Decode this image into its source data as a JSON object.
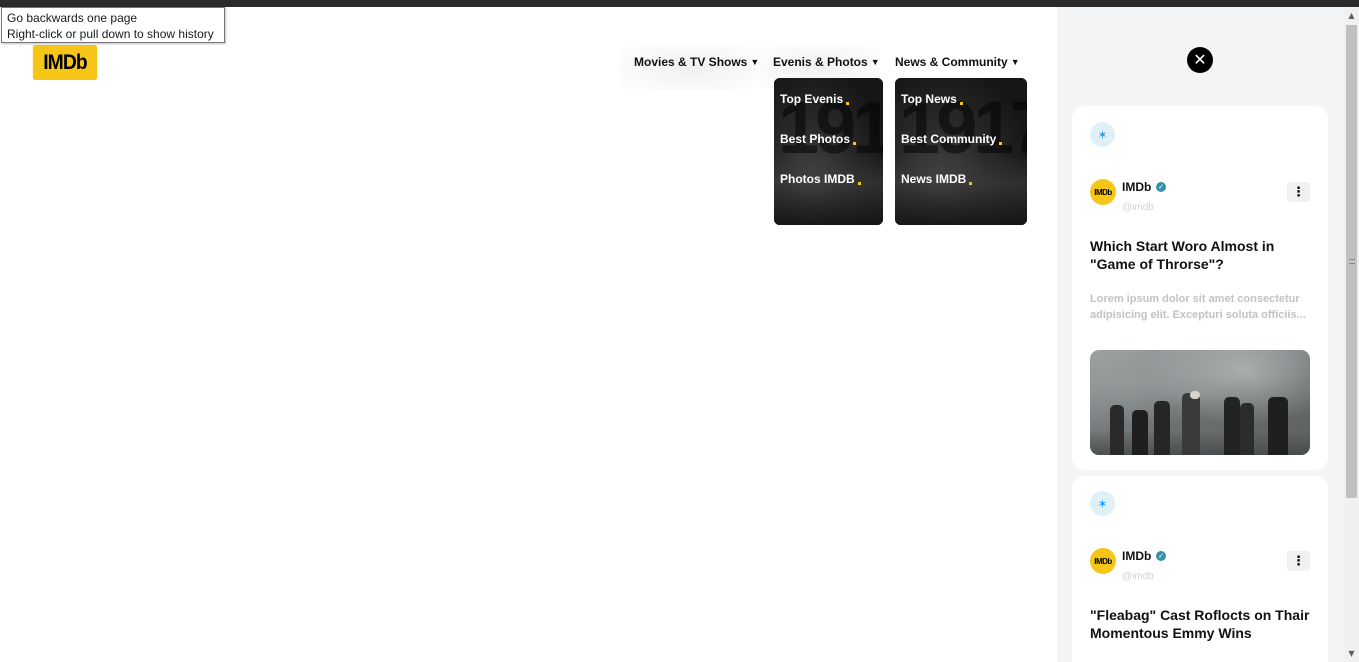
{
  "tooltip": {
    "line1": "Go backwards one page",
    "line2": "Right-click or pull down to show history"
  },
  "logo": {
    "text": "IMDb",
    "color": "#f5c518"
  },
  "nav": {
    "items": [
      {
        "label": "Movies & TV Shows",
        "icon": "chevron-down-icon"
      },
      {
        "label": "Evenis & Photos",
        "icon": "chevron-down-icon"
      },
      {
        "label": "News & Community",
        "icon": "chevron-down-icon"
      }
    ]
  },
  "dropdowns": {
    "events": {
      "bg_text": "1917",
      "items": [
        "Top Evenis",
        "Best Photos",
        "Photos IMDB"
      ]
    },
    "news": {
      "bg_text": "1917",
      "items": [
        "Top News",
        "Best Community",
        "News IMDB"
      ]
    }
  },
  "sidebar": {
    "close_icon": "close-icon",
    "cards": [
      {
        "network_icon": "twitter-icon",
        "avatar_text": "IMDb",
        "user": "IMDb",
        "handle": "@imdb",
        "verified": true,
        "title": "Which Start Woro Almost in \"Game of Throrse\"?",
        "excerpt": "Lorem ipsum dolor sit amet consectetur adipisicing elit. Excepturi soluta officiis...",
        "has_image": true
      },
      {
        "network_icon": "twitter-icon",
        "avatar_text": "IMDb",
        "user": "IMDb",
        "handle": "@imdb",
        "verified": true,
        "title": "\"Fleabag\" Cast Roflocts on Thair Momentous Emmy Wins"
      }
    ]
  },
  "colors": {
    "brand_yellow": "#f5c518",
    "sidebar_bg": "#f3f4f6",
    "twitter_blue": "#1da1f2"
  }
}
